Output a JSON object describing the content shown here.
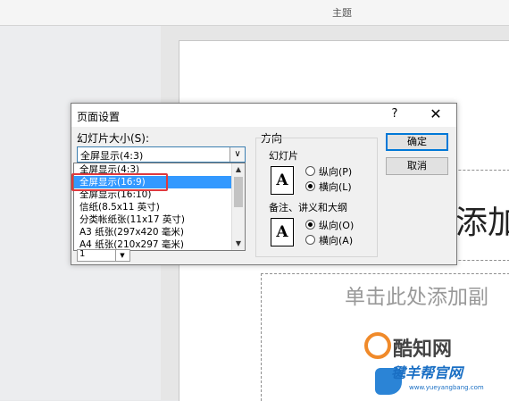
{
  "ribbon": {
    "label": "主题"
  },
  "slide": {
    "title_text": "添加",
    "subtitle_text": "单击此处添加副"
  },
  "watermarks": {
    "mark1_text": "酷知网",
    "mark2_text": "毽羊帮官网",
    "mark2_url": "www.yueyangbang.com"
  },
  "dialog": {
    "title": "页面设置",
    "help_glyph": "?",
    "close_glyph": "✕",
    "size_label": "幻灯片大小(S):",
    "combo_value": "全屏显示(4:3)",
    "combo_arrow": "∨",
    "list_items": [
      "全屏显示(4:3)",
      "全屏显示(16:9)",
      "全屏显示(16:10)",
      "信纸(8.5x11 英寸)",
      "分类帐纸张(11x17 英寸)",
      "A3 纸张(297x420 毫米)",
      "A4 纸张(210x297 毫米)"
    ],
    "selected_index": 1,
    "scroll_up_glyph": "▲",
    "scroll_down_glyph": "▼",
    "spin_value": "1",
    "spin_arrow": "▼",
    "orientation_header": "方向",
    "slides_group_label": "幻灯片",
    "slides_portrait": "纵向(P)",
    "slides_landscape": "横向(L)",
    "slides_selected": "landscape",
    "notes_group_label": "备注、讲义和大纲",
    "notes_portrait": "纵向(O)",
    "notes_landscape": "横向(A)",
    "notes_selected": "portrait",
    "icon_letter": "A",
    "ok_label": "确定",
    "cancel_label": "取消"
  }
}
